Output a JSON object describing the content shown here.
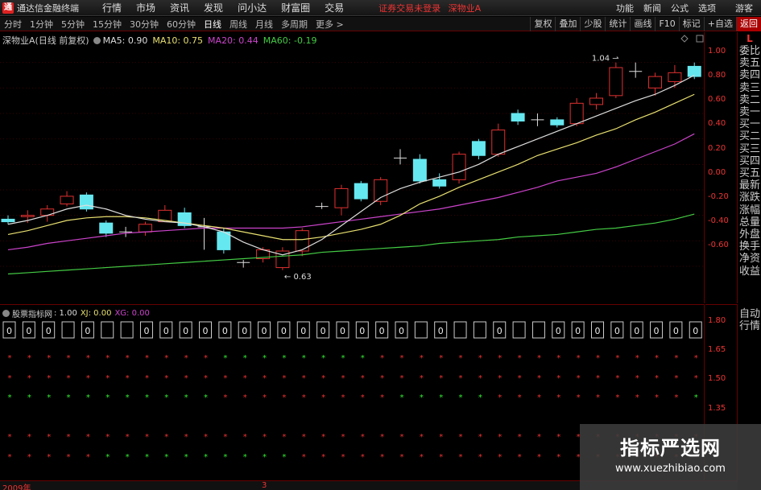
{
  "app": {
    "title": "通达信金融终端",
    "menu": [
      "行情",
      "市场",
      "资讯",
      "发现",
      "问小达",
      "财富圈",
      "交易"
    ],
    "notice": [
      "证券交易未登录",
      "深物业A"
    ],
    "right_menu": [
      "功能",
      "新闻",
      "公式",
      "选项"
    ],
    "guest": "游客"
  },
  "toolbar": {
    "periods": [
      "分时",
      "1分钟",
      "5分钟",
      "15分钟",
      "30分钟",
      "60分钟",
      "日线",
      "周线",
      "月线",
      "多周期",
      "更多 >"
    ],
    "active_period": "日线",
    "tools": [
      "复权",
      "叠加",
      "少股",
      "统计",
      "画线",
      "F10",
      "标记",
      "+自选",
      "返回"
    ]
  },
  "main_chart": {
    "stock_label": "深物业A(日线 前复权)",
    "ma_labels": [
      {
        "text": "MA5: 0.90",
        "color": "#dddddd"
      },
      {
        "text": "MA10: 0.75",
        "color": "#e8e070"
      },
      {
        "text": "MA20: 0.44",
        "color": "#cc44cc"
      },
      {
        "text": "MA60: -0.19",
        "color": "#44cc44"
      }
    ],
    "annotations": {
      "high": "1.04",
      "low": "0.63"
    },
    "y_ticks": [
      "1.00",
      "0.80",
      "0.60",
      "0.40",
      "0.20",
      "0.00",
      "-0.20",
      "-0.40",
      "-0.60"
    ],
    "colors": {
      "up": "#e03030",
      "down": "#66e8f0",
      "doji": "#dddddd"
    }
  },
  "chart_data": {
    "type": "candlestick",
    "y_range": [
      -0.72,
      1.08
    ],
    "candles": [
      [
        -0.23,
        -0.25,
        -0.2,
        -0.27
      ],
      [
        -0.21,
        -0.2,
        -0.16,
        -0.26
      ],
      [
        -0.2,
        -0.15,
        -0.12,
        -0.25
      ],
      [
        -0.11,
        -0.05,
        -0.01,
        -0.13
      ],
      [
        -0.04,
        -0.15,
        -0.02,
        -0.17
      ],
      [
        -0.26,
        -0.34,
        -0.24,
        -0.37
      ],
      [
        -0.33,
        -0.33,
        -0.29,
        -0.37
      ],
      [
        -0.33,
        -0.27,
        -0.25,
        -0.36
      ],
      [
        -0.25,
        -0.16,
        -0.12,
        -0.25
      ],
      [
        -0.18,
        -0.28,
        -0.14,
        -0.3
      ],
      [
        -0.29,
        -0.29,
        -0.22,
        -0.47
      ],
      [
        -0.33,
        -0.47,
        -0.3,
        -0.5
      ],
      [
        -0.57,
        -0.57,
        -0.55,
        -0.61
      ],
      [
        -0.54,
        -0.47,
        -0.45,
        -0.57
      ],
      [
        -0.61,
        -0.48,
        -0.45,
        -0.63
      ],
      [
        -0.48,
        -0.32,
        -0.3,
        -0.52
      ],
      [
        -0.13,
        -0.13,
        -0.1,
        -0.15
      ],
      [
        -0.14,
        0.01,
        0.04,
        -0.2
      ],
      [
        0.05,
        -0.07,
        0.07,
        -0.09
      ],
      [
        -0.09,
        0.08,
        0.1,
        -0.12
      ],
      [
        0.25,
        0.25,
        0.32,
        0.2
      ],
      [
        0.24,
        0.07,
        0.28,
        0.05
      ],
      [
        0.08,
        0.03,
        0.13,
        0.01
      ],
      [
        0.08,
        0.28,
        0.3,
        0.05
      ],
      [
        0.38,
        0.27,
        0.4,
        0.24
      ],
      [
        0.28,
        0.47,
        0.52,
        0.26
      ],
      [
        0.6,
        0.54,
        0.63,
        0.51
      ],
      [
        0.55,
        0.55,
        0.6,
        0.5
      ],
      [
        0.55,
        0.51,
        0.57,
        0.49
      ],
      [
        0.52,
        0.68,
        0.72,
        0.5
      ],
      [
        0.67,
        0.72,
        0.76,
        0.63
      ],
      [
        0.74,
        0.96,
        1.0,
        0.72
      ],
      [
        0.93,
        0.93,
        1.0,
        0.88
      ],
      [
        0.8,
        0.89,
        0.92,
        0.74
      ],
      [
        0.85,
        0.92,
        0.98,
        0.8
      ],
      [
        0.97,
        0.89,
        1.0,
        0.87
      ]
    ],
    "ma5": [
      -0.27,
      -0.24,
      -0.2,
      -0.15,
      -0.12,
      -0.15,
      -0.2,
      -0.23,
      -0.25,
      -0.26,
      -0.29,
      -0.33,
      -0.41,
      -0.47,
      -0.51,
      -0.47,
      -0.39,
      -0.28,
      -0.17,
      -0.06,
      0.01,
      0.06,
      0.1,
      0.14,
      0.2,
      0.28,
      0.34,
      0.4,
      0.46,
      0.52,
      0.58,
      0.64,
      0.7,
      0.75,
      0.82,
      0.9
    ],
    "ma10": [
      -0.35,
      -0.32,
      -0.28,
      -0.24,
      -0.22,
      -0.21,
      -0.21,
      -0.22,
      -0.24,
      -0.26,
      -0.28,
      -0.3,
      -0.33,
      -0.36,
      -0.39,
      -0.39,
      -0.37,
      -0.34,
      -0.31,
      -0.27,
      -0.2,
      -0.11,
      -0.05,
      0.02,
      0.08,
      0.14,
      0.2,
      0.27,
      0.32,
      0.37,
      0.43,
      0.48,
      0.55,
      0.61,
      0.68,
      0.75
    ],
    "ma20": [
      -0.47,
      -0.45,
      -0.42,
      -0.4,
      -0.38,
      -0.36,
      -0.34,
      -0.33,
      -0.32,
      -0.31,
      -0.3,
      -0.3,
      -0.3,
      -0.3,
      -0.3,
      -0.29,
      -0.27,
      -0.25,
      -0.23,
      -0.21,
      -0.19,
      -0.17,
      -0.15,
      -0.12,
      -0.09,
      -0.06,
      -0.02,
      0.02,
      0.07,
      0.1,
      0.13,
      0.18,
      0.24,
      0.3,
      0.36,
      0.44
    ],
    "ma60": [
      -0.66,
      -0.65,
      -0.64,
      -0.63,
      -0.62,
      -0.61,
      -0.6,
      -0.59,
      -0.58,
      -0.57,
      -0.56,
      -0.55,
      -0.54,
      -0.53,
      -0.52,
      -0.51,
      -0.49,
      -0.48,
      -0.47,
      -0.46,
      -0.45,
      -0.44,
      -0.42,
      -0.41,
      -0.4,
      -0.39,
      -0.37,
      -0.36,
      -0.35,
      -0.33,
      -0.31,
      -0.3,
      -0.28,
      -0.26,
      -0.23,
      -0.19
    ]
  },
  "sub_chart": {
    "label_prefix": "股票指标网",
    "values": [
      {
        "text": ": 1.00",
        "color": "#dddddd"
      },
      {
        "text": "XJ: 0.00",
        "color": "#e8e070"
      },
      {
        "text": "XG: 0.00",
        "color": "#cc44cc"
      }
    ],
    "y_ticks": [
      "1.80",
      "1.65",
      "1.50",
      "1.35"
    ],
    "box_value": "0",
    "box_count": 36,
    "empty_boxes": [
      3,
      5,
      6,
      21,
      23,
      24,
      26,
      27
    ],
    "star_rows": [
      {
        "y": 65,
        "stars": "rrrrrrrrrrrggggggggrrrrrrrrrrrrrrrrrr"
      },
      {
        "y": 90,
        "stars": "rrrrrrrrrrrrrrrrrrrrrrrrrrrrrrrrrrrrr"
      },
      {
        "y": 114,
        "stars": "gggggggggggrrrrrrrrrgggggrrrrrrrrrrgg"
      },
      {
        "y": 163,
        "stars": "rrrrrrrrrrrrrrrrrrrrrrrrrrrrrrrrrrrrr"
      },
      {
        "y": 188,
        "stars": "rrrrrggggggggggrrrrrrrrrrrrrrrrrrrrrr"
      }
    ]
  },
  "dates": [
    "2009年",
    "3"
  ],
  "side_panel": {
    "top": "L",
    "items": [
      "委比",
      "卖五",
      "卖四",
      "卖三",
      "卖二",
      "卖一",
      "买一",
      "买二",
      "买三",
      "买四",
      "买五",
      "最新",
      "涨跌",
      "涨幅",
      "总量",
      "外盘",
      "换手",
      "净资",
      "收益"
    ],
    "bottom": [
      "自动",
      "行情"
    ]
  },
  "watermark": {
    "line1": "指标严选网",
    "line2": "www.xuezhibiao.com"
  }
}
